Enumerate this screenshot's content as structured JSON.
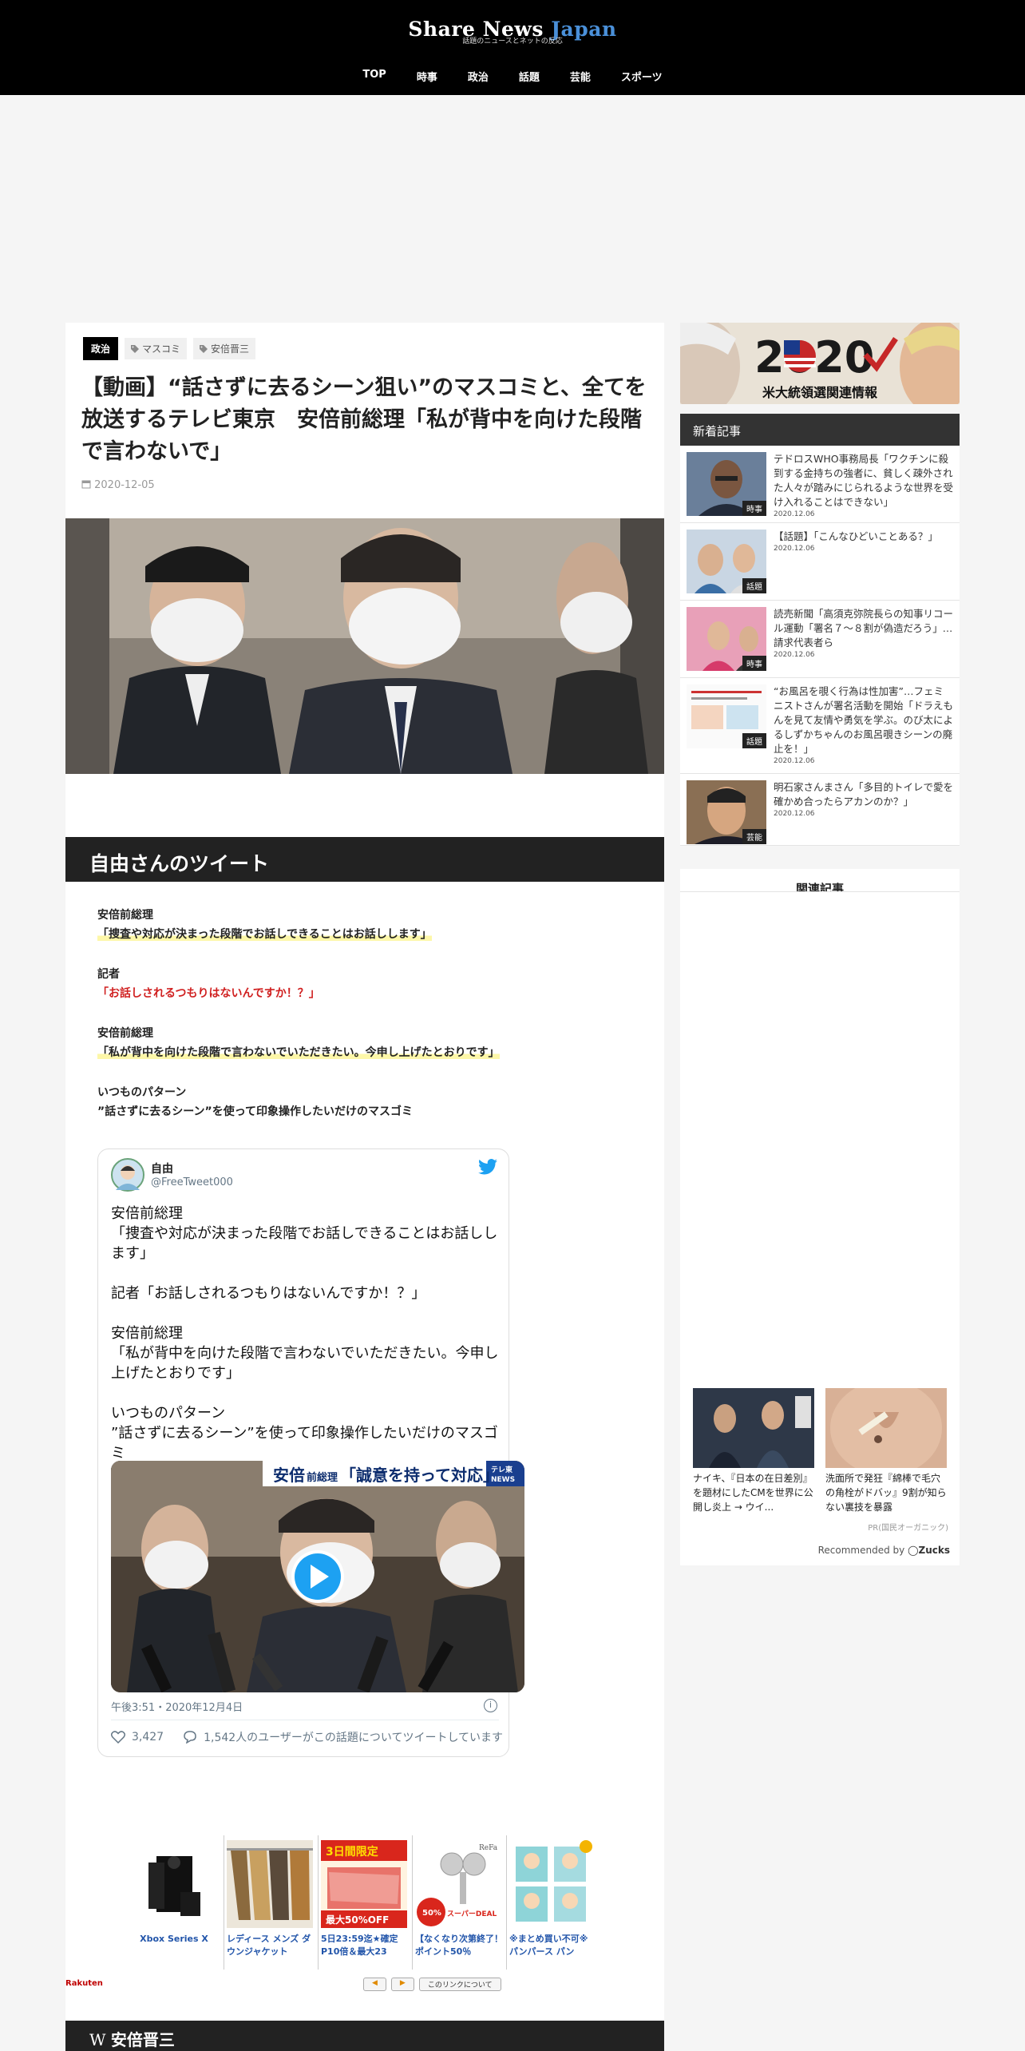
{
  "site": {
    "logo_main": "Share News ",
    "logo_accent": "Japan",
    "tagline": "話題のニュースとネットの反応"
  },
  "nav": [
    "TOP",
    "時事",
    "政治",
    "話題",
    "芸能",
    "スポーツ"
  ],
  "article": {
    "category": "政治",
    "tags": [
      "マスコミ",
      "安倍晋三"
    ],
    "title": "【動画】“話さずに去るシーン狙い”のマスコミと、全てを放送するテレビ東京　安倍前総理「私が背中を向けた段階で言わないで」",
    "date": "2020-12-05",
    "section_heading": "自由さんのツイート",
    "quotes": [
      {
        "speaker": "安倍前総理",
        "text": "「捜査や対応が決まった段階でお話しできることはお話しします」"
      },
      {
        "speaker": "記者",
        "text": "「お話しされるつもりはないんですか！？」"
      },
      {
        "speaker": "安倍前総理",
        "text": "「私が背中を向けた段階で言わないでいただきたい。今申し上げたとおりです」"
      },
      {
        "speaker": "いつものパターン",
        "text": "”話さずに去るシーン”を使って印象操作したいだけのマスゴミ"
      }
    ],
    "footer_heading": "安倍晋三"
  },
  "tweet": {
    "name": "自由",
    "handle": "@FreeTweet000",
    "text": "安倍前総理\n「捜査や対応が決まった段階でお話しできることはお話しします」\n\n記者「お話しされるつもりはないんですか！？」\n\n安倍前総理\n「私が背中を向けた段階で言わないでいただきたい。今申し上げたとおりです」\n\nいつものパターン\n”話さずに去るシーン”を使って印象操作したいだけのマスゴミ",
    "video_caption_small": "安倍",
    "video_caption_mid": "前総理",
    "video_caption_big": "「誠意を持って対応」",
    "video_logo_1": "テレ東",
    "video_logo_2": "NEWS",
    "timestamp": "午後3:51・2020年12月4日",
    "likes": "3,427",
    "replies_text": "1,542人のユーザーがこの話題についてツイートしています"
  },
  "ads": {
    "items": [
      "Xbox Series X",
      "レディース メンズ ダウンジャケット",
      "5日23:59迄★確定P10倍＆最大23",
      "【なくなり次第終了！ポイント50％",
      "※まとめ買い不可※パンパース パン"
    ],
    "img_texts": {
      "sale_top": "3日間限定",
      "sale_pct": "最大50%OFF",
      "deal_pct": "50%",
      "deal_label": "スーパーDEAL",
      "brand": "ReFa"
    },
    "brand": "Rakuten",
    "prev": "◀",
    "next": "▶",
    "about": "このリンクについて"
  },
  "sidebar": {
    "banner_year": "2020",
    "banner_text": "米大統領選関連情報",
    "new_heading": "新着記事",
    "news": [
      {
        "title": "テドロスWHO事務局長「ワクチンに殺到する金持ちの強者に、貧しく疎外された人々が踏みにじられるような世界を受け入れることはできない」",
        "date": "2020.12.06",
        "cat": "時事"
      },
      {
        "title": "【話題】「こんなひどいことある？」",
        "date": "2020.12.06",
        "cat": "話題"
      },
      {
        "title": "読売新聞「高須克弥院長らの知事リコール運動「署名７～８割が偽造だろう」…請求代表者ら",
        "date": "2020.12.06",
        "cat": "時事"
      },
      {
        "title": "“お風呂を覗く行為は性加害”…フェミニストさんが署名活動を開始「ドラえもんを見て友情や勇気を学ぶ。のび太によるしずかちゃんのお風呂覗きシーンの廃止を！」",
        "date": "2020.12.06",
        "cat": "話題"
      },
      {
        "title": "明石家さんまさん「多目的トイレで愛を確かめ合ったらアカンのか？」",
        "date": "2020.12.06",
        "cat": "芸能"
      }
    ],
    "related_heading": "関連記事",
    "recommend": [
      {
        "title": "ナイキ、『日本の在日差別』を題材にしたCMを世界に公開し炎上 → ウイ..."
      },
      {
        "title": "洗面所で発狂『綿棒で毛穴の角栓がドバッ』9割が知らない裏技を暴露"
      }
    ],
    "pr": "PR(国民オーガニック)",
    "recommended_by": "Recommended by",
    "zucks": "Zucks"
  },
  "colors": {
    "header_bg": "#000000",
    "accent": "#4a90d9",
    "section_bg": "#222222",
    "twitter": "#1da1f2",
    "highlight": "#fdf7a8",
    "red_text": "#d02020"
  }
}
